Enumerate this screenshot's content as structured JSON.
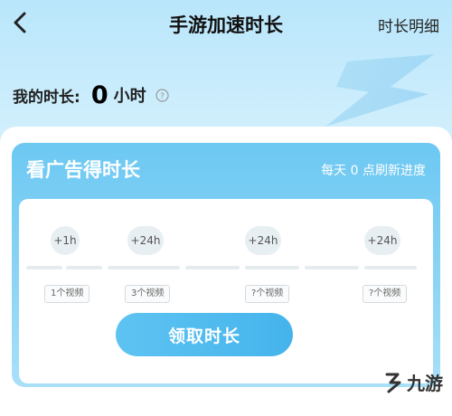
{
  "header": {
    "title": "手游加速时长",
    "detail_link": "时长明细"
  },
  "duration": {
    "label": "我的时长:",
    "value": "0",
    "unit": "小时"
  },
  "ad_card": {
    "title": "看广告得时长",
    "refresh_note": "每天 0 点刷新进度",
    "rewards": [
      {
        "amount": "+1h",
        "requirement": "1个视频"
      },
      {
        "amount": "+24h",
        "requirement": "3个视频"
      },
      {
        "amount": "+24h",
        "requirement": "?个视频"
      },
      {
        "amount": "+24h",
        "requirement": "?个视频"
      }
    ],
    "claim_button": "领取时长"
  },
  "watermark": {
    "text": "九游"
  }
}
